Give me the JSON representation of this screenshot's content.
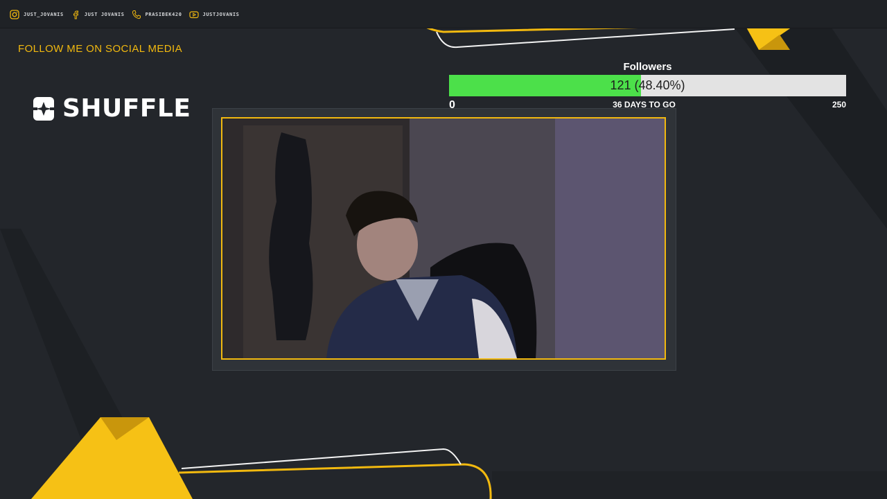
{
  "social": [
    {
      "icon": "instagram-icon",
      "label": "JUST_JOVANIS"
    },
    {
      "icon": "facebook-icon",
      "label": "JUST JOVANIS"
    },
    {
      "icon": "phone-icon",
      "label": "PRASIBEK420"
    },
    {
      "icon": "youtube-icon",
      "label": "JUSTJOVANIS"
    }
  ],
  "follow_text": "FOLLOW ME ON SOCIAL MEDIA",
  "brand": {
    "name": "SHUFFLE",
    "icon": "shuffle-logo-icon"
  },
  "goal": {
    "title": "Followers",
    "current": 121,
    "target": 250,
    "progress_fraction": 0.484,
    "value_text": "121 (48.40%)",
    "min_label": "0",
    "max_label": "250",
    "days_text": "36 DAYS TO GO"
  },
  "colors": {
    "accent": "#f2b90f",
    "background": "#23262b",
    "progress_fill": "#4ce04a",
    "progress_track": "#e3e3e3"
  }
}
